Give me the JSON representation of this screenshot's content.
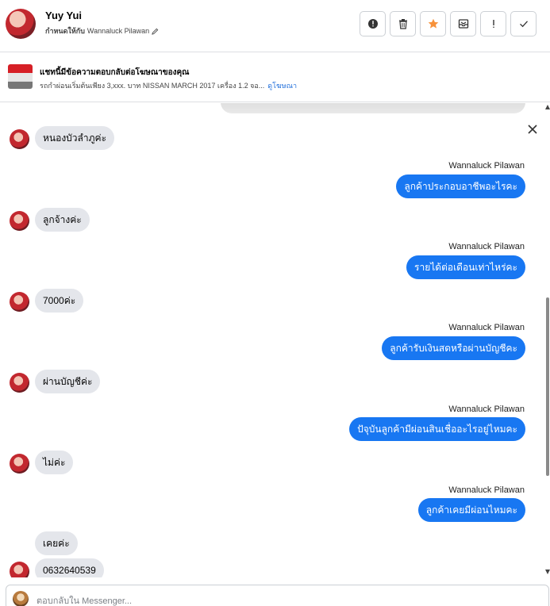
{
  "header": {
    "name": "Yuy Yui",
    "assigned_label": "กำหนดให้กับ",
    "assigned_to": "Wannaluck Pilawan",
    "actions": [
      {
        "name": "alert-circle-icon"
      },
      {
        "name": "trash-icon"
      },
      {
        "name": "star-icon",
        "color": "#f7923b"
      },
      {
        "name": "mark-unread-icon"
      },
      {
        "name": "exclamation-icon"
      },
      {
        "name": "check-icon"
      }
    ]
  },
  "ad": {
    "title": "แชทนี้มีข้อความตอบกลับต่อโฆษณาของคุณ",
    "description": "รถกำผ่อนเริ่มต้นเพียง 3,xxx. บาท NISSAN MARCH 2017 เครื่อง 1.2 จอ...",
    "link": "ดูโฆษณา"
  },
  "messages": {
    "m1": "หนองบัวลำภูค่ะ",
    "m2_sender": "Wannaluck Pilawan",
    "m2": "ลูกค้าประกอบอาชีพอะไรคะ",
    "m3": "ลูกจ้างค่ะ",
    "m4_sender": "Wannaluck Pilawan",
    "m4": "รายได้ต่อเดือนเท่าไหร่คะ",
    "m5": "7000ค่ะ",
    "m6_sender": "Wannaluck Pilawan",
    "m6": "ลูกค้ารับเงินสดหรือผ่านบัญชีคะ",
    "m7": "ผ่านบัญชีค่ะ",
    "m8_sender": "Wannaluck Pilawan",
    "m8": "ปัจุบันลูกค้ามีผ่อนสินเชื่ออะไรอยู่ไหมคะ",
    "m9": "ไม่ค่ะ",
    "m10_sender": "Wannaluck Pilawan",
    "m10": "ลูกค้าเคยมีผ่อนไหมคะ",
    "m11": "เคยค่ะ",
    "m12": "0632640539"
  },
  "composer": {
    "placeholder": "ตอบกลับใน Messenger..."
  },
  "colors": {
    "outgoing_bubble": "#1877f2",
    "incoming_bubble": "#e4e6eb"
  }
}
